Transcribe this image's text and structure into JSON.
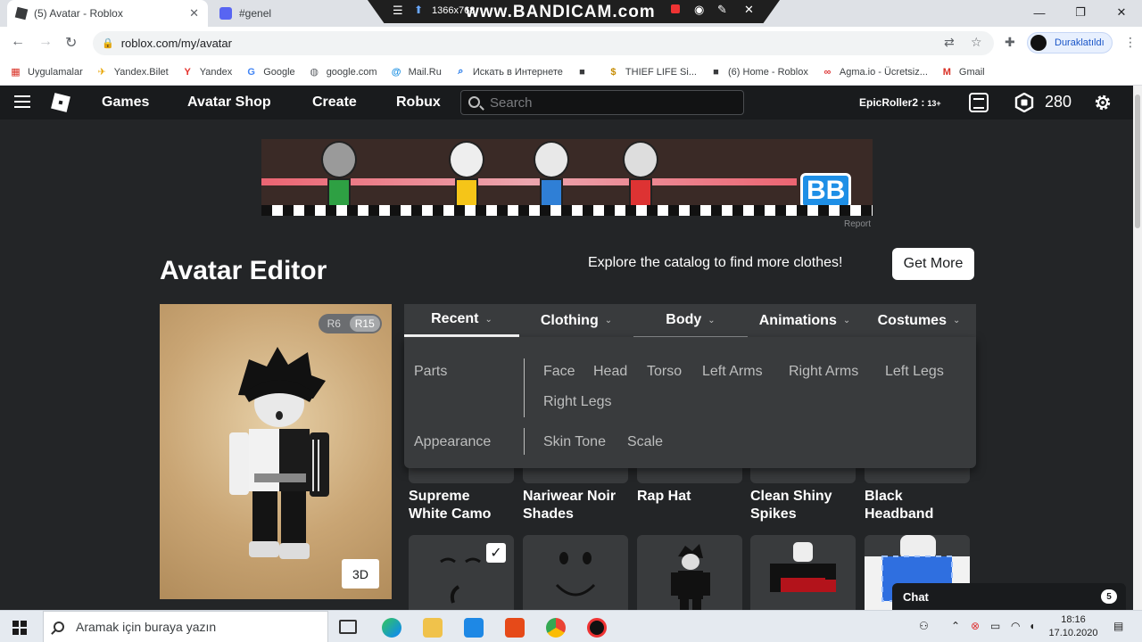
{
  "browser": {
    "tabs": [
      {
        "title": "(5) Avatar - Roblox",
        "active": true
      },
      {
        "title": "#genel",
        "active": false
      }
    ],
    "recorder": {
      "resolution": "1366x768",
      "watermark": "www.BANDICAM.com"
    },
    "url": "roblox.com/my/avatar",
    "profile_label": "Duraklatıldı",
    "bookmarks": [
      {
        "label": "Uygulamalar",
        "icon": "apps-grid-icon",
        "color": "#d93025"
      },
      {
        "label": "Yandex.Bilet",
        "icon": "plane-icon",
        "color": "#e8a400"
      },
      {
        "label": "Yandex",
        "icon": "yandex-icon",
        "color": "#e5322d"
      },
      {
        "label": "Google",
        "icon": "google-icon",
        "color": "#4285f4"
      },
      {
        "label": "google.com",
        "icon": "globe-icon",
        "color": "#5f6368"
      },
      {
        "label": "Mail.Ru",
        "icon": "at-icon",
        "color": "#168de2"
      },
      {
        "label": "Искать в Интернете",
        "icon": "search-icon",
        "color": "#1a73e8"
      },
      {
        "label": "",
        "icon": "roblox-icon",
        "color": "#393b3d"
      },
      {
        "label": "THIEF LIFE Si...",
        "icon": "money-bag-icon",
        "color": "#c58a00"
      },
      {
        "label": "(6) Home - Roblox",
        "icon": "roblox-icon",
        "color": "#393b3d"
      },
      {
        "label": "Agma.io - Ücretsiz...",
        "icon": "agma-icon",
        "color": "#d33"
      },
      {
        "label": "Gmail",
        "icon": "gmail-icon",
        "color": "#d93025"
      }
    ]
  },
  "roblox": {
    "nav": [
      "Games",
      "Avatar Shop",
      "Create",
      "Robux"
    ],
    "search_placeholder": "Search",
    "username": "EpicRoller2 :",
    "age_label": "13+",
    "robux": "280",
    "ad_report": "Report",
    "ad_logo": "BB"
  },
  "editor": {
    "title": "Avatar Editor",
    "explore_text": "Explore the catalog to find more clothes!",
    "get_more": "Get More",
    "rig": {
      "r6": "R6",
      "r15": "R15",
      "selected": "R15"
    },
    "view_3d": "3D",
    "tabs": [
      {
        "label": "Recent",
        "selected": true
      },
      {
        "label": "Clothing",
        "selected": false
      },
      {
        "label": "Body",
        "selected": false,
        "hovered": true
      },
      {
        "label": "Animations",
        "selected": false
      },
      {
        "label": "Costumes",
        "selected": false
      }
    ],
    "body_menu": {
      "parts_header": "Parts",
      "parts": [
        "Face",
        "Head",
        "Torso",
        "Left Arms",
        "Right Arms",
        "Left Legs",
        "Right Legs"
      ],
      "appearance_header": "Appearance",
      "appearance": [
        "Skin Tone",
        "Scale"
      ]
    },
    "items_row1": [
      {
        "name_line1": "Supreme",
        "name_line2": "White Camo"
      },
      {
        "name_line1": "Nariwear Noir",
        "name_line2": "Shades"
      },
      {
        "name_line1": "Rap Hat",
        "name_line2": ""
      },
      {
        "name_line1": "Clean Shiny",
        "name_line2": "Spikes"
      },
      {
        "name_line1": "Black",
        "name_line2": "Headband"
      }
    ]
  },
  "chat": {
    "label": "Chat",
    "unread": "5"
  },
  "taskbar": {
    "search_placeholder": "Aramak için buraya yazın",
    "time": "18:16",
    "date": "17.10.2020"
  }
}
